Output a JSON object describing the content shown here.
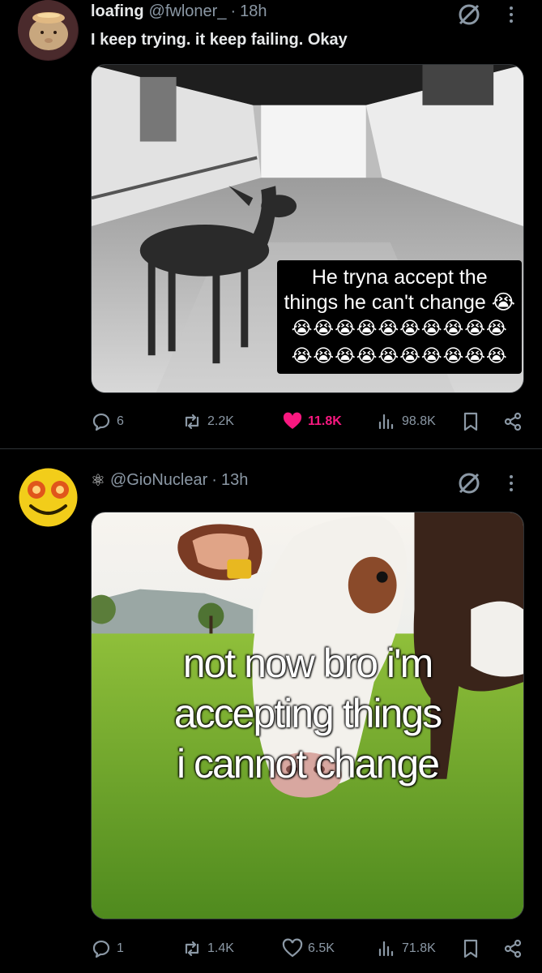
{
  "posts": [
    {
      "name": "loafing",
      "handle": "@fwloner_",
      "time": "18h",
      "text": "I keep trying. it keep failing. Okay",
      "media_caption": {
        "line1": "He tryna accept the",
        "line2": "things he can't change 😭",
        "emoji_row1": "😭😭😭😭😭😭😭😭😭😭",
        "emoji_row2": "😭😭😭😭😭😭😭😭😭😭"
      },
      "stats": {
        "replies": "6",
        "reposts": "2.2K",
        "likes": "11.8K",
        "views": "98.8K"
      },
      "liked": true
    },
    {
      "name": "⚛",
      "handle": "@GioNuclear",
      "time": "13h",
      "text": "",
      "media_caption": {
        "line1": "not now bro i'm",
        "line2": "accepting things",
        "line3": "i cannot change"
      },
      "stats": {
        "replies": "1",
        "reposts": "1.4K",
        "likes": "6.5K",
        "views": "71.8K"
      },
      "liked": false
    }
  ],
  "colors": {
    "background": "#000000",
    "text": "#e7e9ea",
    "muted": "#8b98a5",
    "like": "#f91880",
    "divider": "#2f3336"
  },
  "icons": [
    "reply-icon",
    "repost-icon",
    "heart-icon",
    "views-icon",
    "bookmark-icon",
    "share-icon",
    "grok-icon",
    "more-icon"
  ]
}
